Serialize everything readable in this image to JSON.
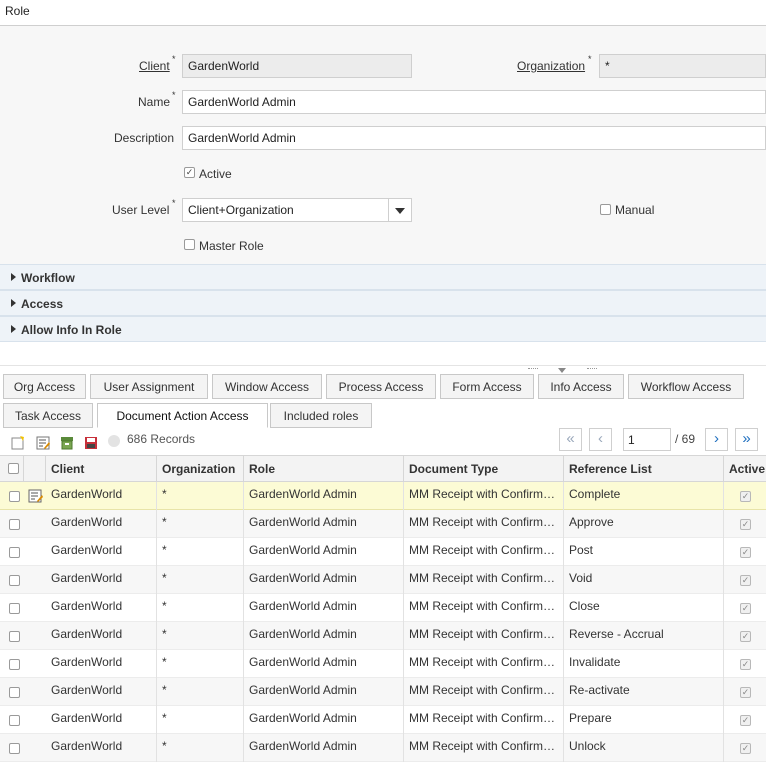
{
  "title": "Role",
  "form": {
    "client_label": "Client",
    "client_value": "GardenWorld",
    "organization_label": "Organization",
    "organization_value": "*",
    "name_label": "Name",
    "name_value": "GardenWorld Admin",
    "description_label": "Description",
    "description_value": "GardenWorld Admin",
    "active_label": "Active",
    "active_checked": true,
    "user_level_label": "User Level",
    "user_level_value": "Client+Organization",
    "manual_label": "Manual",
    "master_role_label": "Master Role",
    "required_mark": "*",
    "check_mark": "✓"
  },
  "groups": [
    "Workflow",
    "Access",
    "Allow Info In Role"
  ],
  "tabs_row1": [
    "Org Access",
    "User Assignment",
    "Window Access",
    "Process Access",
    "Form Access",
    "Info Access",
    "Workflow Access"
  ],
  "tabs_row2": [
    "Task Access",
    "Document Action Access",
    "Included roles"
  ],
  "selected_tab": "Document Action Access",
  "toolbar": {
    "records": "686 Records",
    "page": "1",
    "page_total": "/ 69",
    "first": "«",
    "prev": "‹",
    "next": "›",
    "last": "»"
  },
  "grid": {
    "columns": [
      "Client",
      "Organization",
      "Role",
      "Document Type",
      "Reference List",
      "Active"
    ],
    "rows": [
      {
        "client": "GardenWorld",
        "org": "*",
        "role": "GardenWorld Admin",
        "doctype": "MM Receipt with Confirmation",
        "ref": "Complete",
        "active": true
      },
      {
        "client": "GardenWorld",
        "org": "*",
        "role": "GardenWorld Admin",
        "doctype": "MM Receipt with Confirmation",
        "ref": "Approve",
        "active": true
      },
      {
        "client": "GardenWorld",
        "org": "*",
        "role": "GardenWorld Admin",
        "doctype": "MM Receipt with Confirmation",
        "ref": "Post",
        "active": true
      },
      {
        "client": "GardenWorld",
        "org": "*",
        "role": "GardenWorld Admin",
        "doctype": "MM Receipt with Confirmation",
        "ref": "Void",
        "active": true
      },
      {
        "client": "GardenWorld",
        "org": "*",
        "role": "GardenWorld Admin",
        "doctype": "MM Receipt with Confirmation",
        "ref": "Close",
        "active": true
      },
      {
        "client": "GardenWorld",
        "org": "*",
        "role": "GardenWorld Admin",
        "doctype": "MM Receipt with Confirmation",
        "ref": "Reverse - Accrual",
        "active": true
      },
      {
        "client": "GardenWorld",
        "org": "*",
        "role": "GardenWorld Admin",
        "doctype": "MM Receipt with Confirmation",
        "ref": "Invalidate",
        "active": true
      },
      {
        "client": "GardenWorld",
        "org": "*",
        "role": "GardenWorld Admin",
        "doctype": "MM Receipt with Confirmation",
        "ref": "Re-activate",
        "active": true
      },
      {
        "client": "GardenWorld",
        "org": "*",
        "role": "GardenWorld Admin",
        "doctype": "MM Receipt with Confirmation",
        "ref": "Prepare",
        "active": true
      },
      {
        "client": "GardenWorld",
        "org": "*",
        "role": "GardenWorld Admin",
        "doctype": "MM Receipt with Confirmation",
        "ref": "Unlock",
        "active": true
      }
    ]
  },
  "colors": {
    "selected_row": "#fcfbd5",
    "group_bg": "#eef3f8",
    "accent": "#1f6fbf"
  }
}
